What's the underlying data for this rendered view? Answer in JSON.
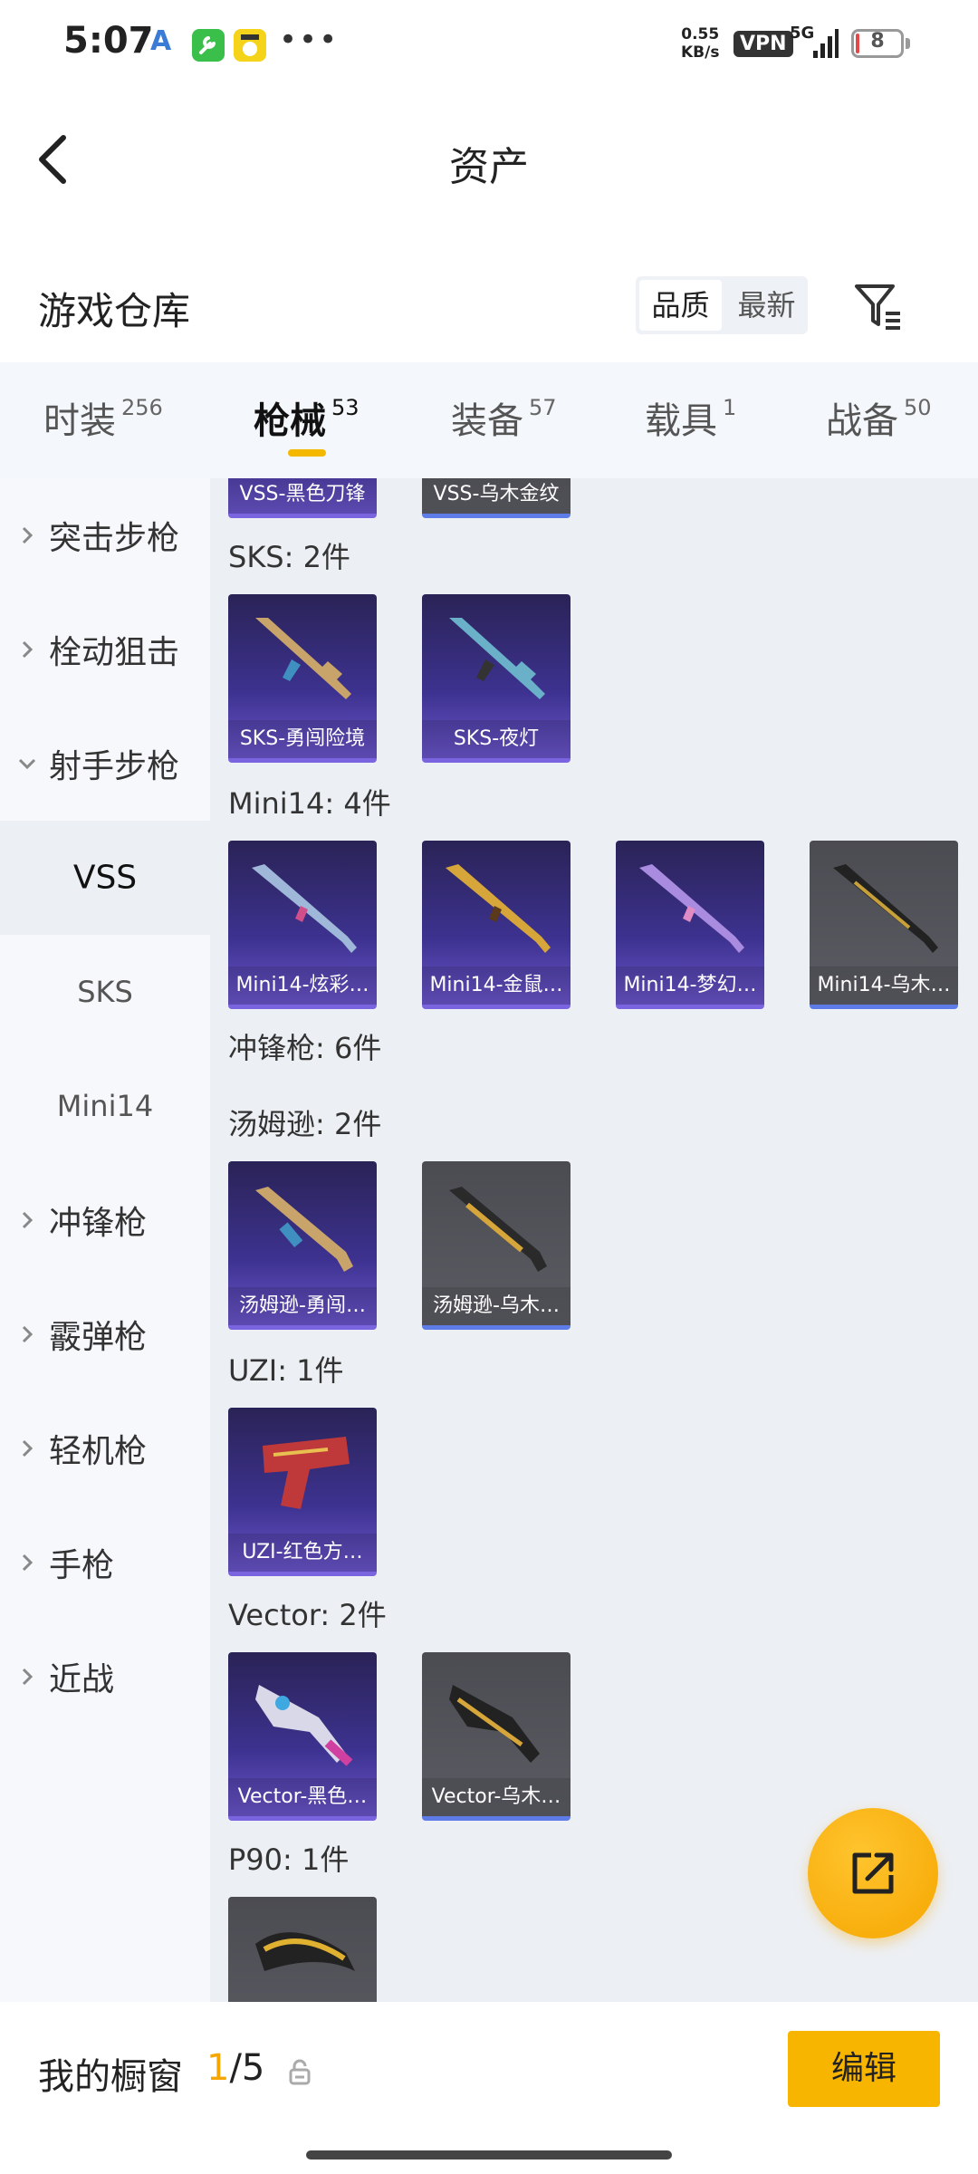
{
  "status_bar": {
    "time": "5:07",
    "app_a": "A",
    "dots": "•••",
    "speed_value": "0.55",
    "speed_unit": "KB/s",
    "vpn": "VPN",
    "network": "5G",
    "battery": "8",
    "battery_level": 0.08
  },
  "nav": {
    "title": "资产"
  },
  "warehouse": {
    "title": "游戏仓库",
    "sort_options": [
      "品质",
      "最新"
    ],
    "active_sort": "品质"
  },
  "tabs": [
    {
      "label": "时装",
      "count": "256"
    },
    {
      "label": "枪械",
      "count": "53",
      "active": true
    },
    {
      "label": "装备",
      "count": "57"
    },
    {
      "label": "载具",
      "count": "1"
    },
    {
      "label": "战备",
      "count": "50"
    }
  ],
  "sidebar": {
    "items": [
      {
        "label": "突击步枪",
        "type": "category",
        "expanded": false
      },
      {
        "label": "栓动狙击",
        "type": "category",
        "expanded": false
      },
      {
        "label": "射手步枪",
        "type": "category",
        "expanded": true
      },
      {
        "label": "VSS",
        "type": "sub",
        "active": true
      },
      {
        "label": "SKS",
        "type": "sub"
      },
      {
        "label": "Mini14",
        "type": "sub"
      },
      {
        "label": "冲锋枪",
        "type": "category",
        "expanded": false
      },
      {
        "label": "霰弹枪",
        "type": "category",
        "expanded": false
      },
      {
        "label": "轻机枪",
        "type": "category",
        "expanded": false
      },
      {
        "label": "手枪",
        "type": "category",
        "expanded": false
      },
      {
        "label": "近战",
        "type": "category",
        "expanded": false
      }
    ]
  },
  "content": {
    "vss_cards": [
      {
        "label": "VSS-黑色刀锋",
        "quality": "purple"
      },
      {
        "label": "VSS-乌木金纹",
        "quality": "gray"
      }
    ],
    "groups": [
      {
        "title": "SKS: 2件",
        "cards": [
          {
            "label": "SKS-勇闯险境",
            "quality": "purple"
          },
          {
            "label": "SKS-夜灯",
            "quality": "purple"
          }
        ]
      },
      {
        "title": "Mini14: 4件",
        "cards": [
          {
            "label": "Mini14-炫彩…",
            "quality": "purple"
          },
          {
            "label": "Mini14-金鼠…",
            "quality": "purple"
          },
          {
            "label": "Mini14-梦幻…",
            "quality": "purple"
          },
          {
            "label": "Mini14-乌木…",
            "quality": "gray"
          }
        ]
      },
      {
        "title": "冲锋枪: 6件",
        "cards": []
      },
      {
        "title": "汤姆逊: 2件",
        "cards": [
          {
            "label": "汤姆逊-勇闯…",
            "quality": "purple"
          },
          {
            "label": "汤姆逊-乌木…",
            "quality": "gray"
          }
        ]
      },
      {
        "title": "UZI: 1件",
        "cards": [
          {
            "label": "UZI-红色方…",
            "quality": "purple"
          }
        ]
      },
      {
        "title": "Vector: 2件",
        "cards": [
          {
            "label": "Vector-黑色…",
            "quality": "purple"
          },
          {
            "label": "Vector-乌木…",
            "quality": "gray"
          }
        ]
      },
      {
        "title": "P90: 1件",
        "cards": [
          {
            "label": "",
            "quality": "gray"
          }
        ]
      }
    ]
  },
  "bottom_bar": {
    "title": "我的橱窗",
    "current": "1",
    "total": "/5",
    "edit_label": "编辑"
  },
  "colors": {
    "accent": "#f5b800",
    "purple_card": "#3d3290",
    "gray_card": "#55565c"
  }
}
